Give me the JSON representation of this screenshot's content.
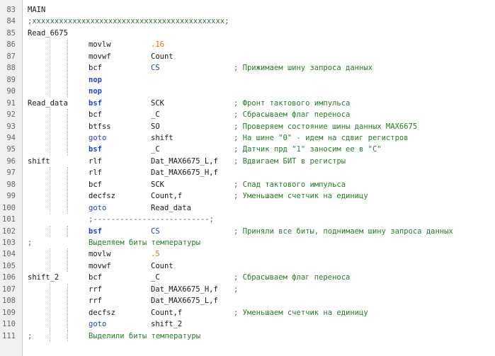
{
  "colors": {
    "text": "#1a1a1a",
    "keyword": "#1f3fd8",
    "number": "#e07000",
    "comment": "#2a7a2a",
    "cs_highlight": "#1f3fd8",
    "gutter_text": "#666666"
  },
  "lines": [
    {
      "n": "83",
      "label": "MAIN",
      "op": "",
      "operand": "",
      "comment": ""
    },
    {
      "n": "84",
      "separator": ";xxxxxxxxxxxxxxxxxxxxxxxxxxxxxxxxxxxxxxxxxxx;",
      "label": "",
      "op": "",
      "operand": "",
      "comment": ""
    },
    {
      "n": "85",
      "label": "Read_6675",
      "op": "",
      "operand": "",
      "comment": ""
    },
    {
      "n": "86",
      "label": "",
      "op": "movlw",
      "operand": ".16",
      "operand_kind": "number",
      "comment": ""
    },
    {
      "n": "87",
      "label": "",
      "op": "movwf",
      "operand": "Count",
      "comment": ""
    },
    {
      "n": "88",
      "label": "",
      "op": "bcf",
      "operand": "CS",
      "operand_kind": "cs",
      "comment": "; Прижимаем шину запроса данных"
    },
    {
      "n": "89",
      "label": "",
      "op": "nop",
      "op_kind": "keyword",
      "operand": "",
      "comment": ""
    },
    {
      "n": "90",
      "label": "",
      "op": "nop",
      "op_kind": "keyword",
      "operand": "",
      "comment": ""
    },
    {
      "n": "91",
      "label": "Read_data",
      "op": "bsf",
      "op_kind": "keyword",
      "operand": "SCK",
      "comment": "; Фронт тактового импульса"
    },
    {
      "n": "92",
      "label": "",
      "op": "bcf",
      "operand": "_C",
      "comment": "; Сбрасываем флаг переноса"
    },
    {
      "n": "93",
      "label": "",
      "op": "btfss",
      "operand": "SO",
      "comment": "; Проверяем состояние шины данных MAX6675"
    },
    {
      "n": "94",
      "label": "",
      "op": "goto",
      "op_kind": "goto",
      "operand": "shift",
      "comment": "; На шине \"0\" - идем на сдвиг регистров"
    },
    {
      "n": "95",
      "label": "",
      "op": "bsf",
      "op_kind": "keyword",
      "operand": "_C",
      "comment": "; Датчик прд \"1\" заносим ее в \"C\""
    },
    {
      "n": "96",
      "label": "shift",
      "op": "rlf",
      "operand": "Dat_MAX6675_L,f",
      "comment": "; Вдвигаем БИТ в регистры"
    },
    {
      "n": "97",
      "label": "",
      "op": "rlf",
      "operand": "Dat_MAX6675_H,f",
      "comment": ""
    },
    {
      "n": "98",
      "label": "",
      "op": "bcf",
      "operand": "SCK",
      "comment": "; Спад тактового импульса"
    },
    {
      "n": "99",
      "label": "",
      "op": "decfsz",
      "operand": "Count,f",
      "comment": "; Уменьшаем счетчик на единицу"
    },
    {
      "n": "100",
      "label": "",
      "op": "goto",
      "op_kind": "goto",
      "operand": "Read_data",
      "comment": ""
    },
    {
      "n": "101",
      "separator": ";--------------------------;",
      "label": "",
      "op": "",
      "operand": "",
      "comment": ""
    },
    {
      "n": "102",
      "label": "",
      "op": "bsf",
      "op_kind": "keyword",
      "operand": "CS",
      "operand_kind": "cs",
      "comment": "; Приняли все биты, поднимаем шину запроса данных"
    },
    {
      "n": "103",
      "label": ";",
      "op": "",
      "operand": "",
      "comment": "",
      "op_comment": "Выделяем биты температуры"
    },
    {
      "n": "104",
      "label": "",
      "op": "movlw",
      "operand": ".5",
      "operand_kind": "number",
      "comment": ""
    },
    {
      "n": "105",
      "label": "",
      "op": "movwf",
      "operand": "Count",
      "comment": ""
    },
    {
      "n": "106",
      "label": "shift_2",
      "op": "bcf",
      "operand": "_C",
      "comment": "; Сбрасываем флаг переноса"
    },
    {
      "n": "107",
      "label": "",
      "op": "rrf",
      "operand": "Dat_MAX6675_H,f",
      "comment": ";"
    },
    {
      "n": "108",
      "label": "",
      "op": "rrf",
      "operand": "Dat_MAX6675_L,f",
      "comment": ""
    },
    {
      "n": "109",
      "label": "",
      "op": "decfsz",
      "operand": "Count,f",
      "comment": "; Уменьшаем счетчик на единицу"
    },
    {
      "n": "110",
      "label": "",
      "op": "goto",
      "op_kind": "goto",
      "operand": "shift_2",
      "comment": ""
    },
    {
      "n": "111",
      "label": ";",
      "op": "",
      "operand": "",
      "comment": "",
      "op_comment": "Выделили биты температуры"
    }
  ]
}
